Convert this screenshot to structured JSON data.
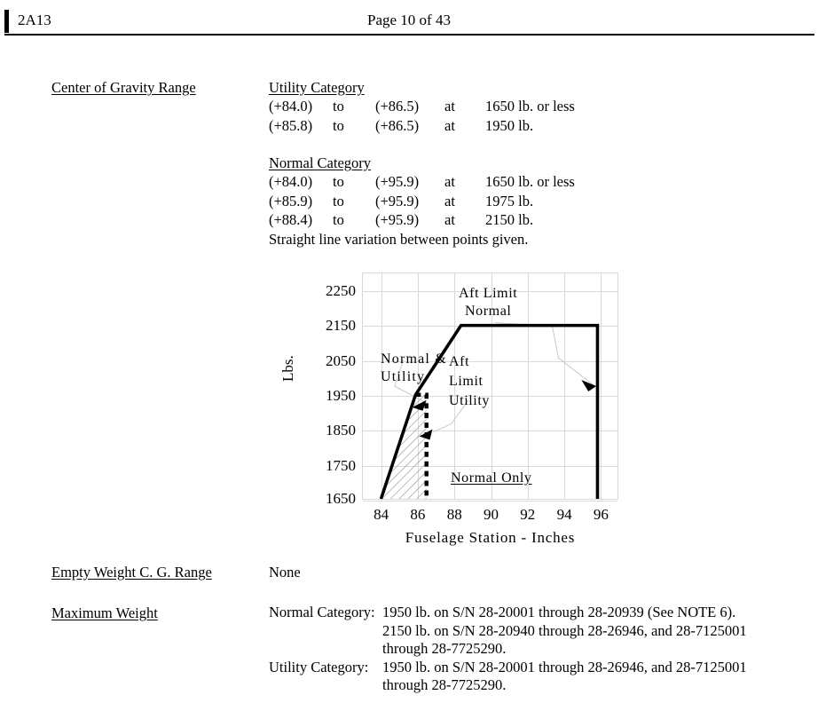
{
  "header": {
    "code": "2A13",
    "page_label": "Page 10 of 43"
  },
  "sections": {
    "cg_range_label": "Center of Gravity Range",
    "empty_weight_label": "Empty Weight C. G. Range",
    "empty_weight_value": "None",
    "maximum_weight_label": "Maximum Weight"
  },
  "cg": {
    "utility_heading": "Utility Category",
    "normal_heading": "Normal Category",
    "utility_rows": [
      {
        "from": "(+84.0)",
        "to": "to",
        "upto": "(+86.5)",
        "at": "at",
        "value": "1650 lb. or less"
      },
      {
        "from": "(+85.8)",
        "to": "to",
        "upto": "(+86.5)",
        "at": "at",
        "value": "1950 lb."
      }
    ],
    "normal_rows": [
      {
        "from": "(+84.0)",
        "to": "to",
        "upto": "(+95.9)",
        "at": "at",
        "value": "1650 lb. or less"
      },
      {
        "from": "(+85.9)",
        "to": "to",
        "upto": "(+95.9)",
        "at": "at",
        "value": "1975 lb."
      },
      {
        "from": "(+88.4)",
        "to": "to",
        "upto": "(+95.9)",
        "at": "at",
        "value": "2150 lb."
      }
    ],
    "note": "Straight line variation between points given."
  },
  "maximum_weight": {
    "rows": [
      {
        "category": "Normal Category:",
        "lines": [
          "1950 lb. on S/N 28-20001 through 28-20939 (See NOTE 6).",
          "2150 lb. on  S/N 28-20940 through 28-26946, and 28-7125001",
          "through 28-7725290."
        ]
      },
      {
        "category": "Utility Category:",
        "lines": [
          "1950 lb. on S/N 28-20001 through 28-26946, and 28-7125001",
          "through 28-7725290."
        ]
      }
    ]
  },
  "chart_data": {
    "type": "line",
    "title": "",
    "xlabel": "Fuselage Station - Inches",
    "ylabel": "Lbs.",
    "xlim": [
      83,
      97
    ],
    "ylim": [
      1650,
      2300
    ],
    "xticks": [
      84,
      86,
      88,
      90,
      92,
      94,
      96
    ],
    "yticks": [
      1650,
      1750,
      1850,
      1950,
      2050,
      2150,
      2250
    ],
    "grid": true,
    "legend": "none",
    "series": [
      {
        "name": "Normal Category envelope",
        "style": "solid-heavy",
        "points": [
          [
            84.0,
            1650
          ],
          [
            85.9,
            1950
          ],
          [
            88.4,
            2150
          ],
          [
            95.9,
            2150
          ],
          [
            95.9,
            1650
          ]
        ]
      },
      {
        "name": "Utility Category aft limit",
        "style": "dashed-heavy",
        "points": [
          [
            86.5,
            1950
          ],
          [
            86.5,
            1650
          ]
        ]
      },
      {
        "name": "Utility Category upper bound",
        "style": "dashed-heavy",
        "points": [
          [
            85.65,
            1950
          ],
          [
            86.5,
            1950
          ]
        ]
      }
    ],
    "shaded_region": {
      "name": "Normal & Utility",
      "fill": "diagonal-hatch",
      "points": [
        [
          84.0,
          1650
        ],
        [
          85.9,
          1950
        ],
        [
          86.5,
          1950
        ],
        [
          86.5,
          1650
        ]
      ]
    },
    "annotations": [
      {
        "text": "Aft Limit",
        "x": 91.0,
        "y": 2255
      },
      {
        "text": "Normal",
        "x": 91.0,
        "y": 2205
      },
      {
        "text": "Normal &",
        "x": 85.0,
        "y": 2070
      },
      {
        "text": "Utility",
        "x": 84.7,
        "y": 2025
      },
      {
        "text": "Aft",
        "x": 88.3,
        "y": 2065
      },
      {
        "text": "Limit",
        "x": 88.3,
        "y": 2020
      },
      {
        "text": "Utility",
        "x": 88.3,
        "y": 1975
      },
      {
        "text": "Normal Only",
        "x": 91.0,
        "y": 1700
      }
    ],
    "leaders": [
      {
        "from_label": "Normal & Utility",
        "to_x": 85.9,
        "to_y": 1760
      },
      {
        "from_label": "Aft Limit Utility",
        "to_x": 86.6,
        "to_y": 1855
      },
      {
        "from_label": "Aft Limit Normal",
        "to_x": 95.8,
        "to_y": 1930
      }
    ],
    "colors": {
      "line": "#000000",
      "grid": "#d9d9d9",
      "leader": "#bfbfbf",
      "text": "#000000"
    }
  }
}
